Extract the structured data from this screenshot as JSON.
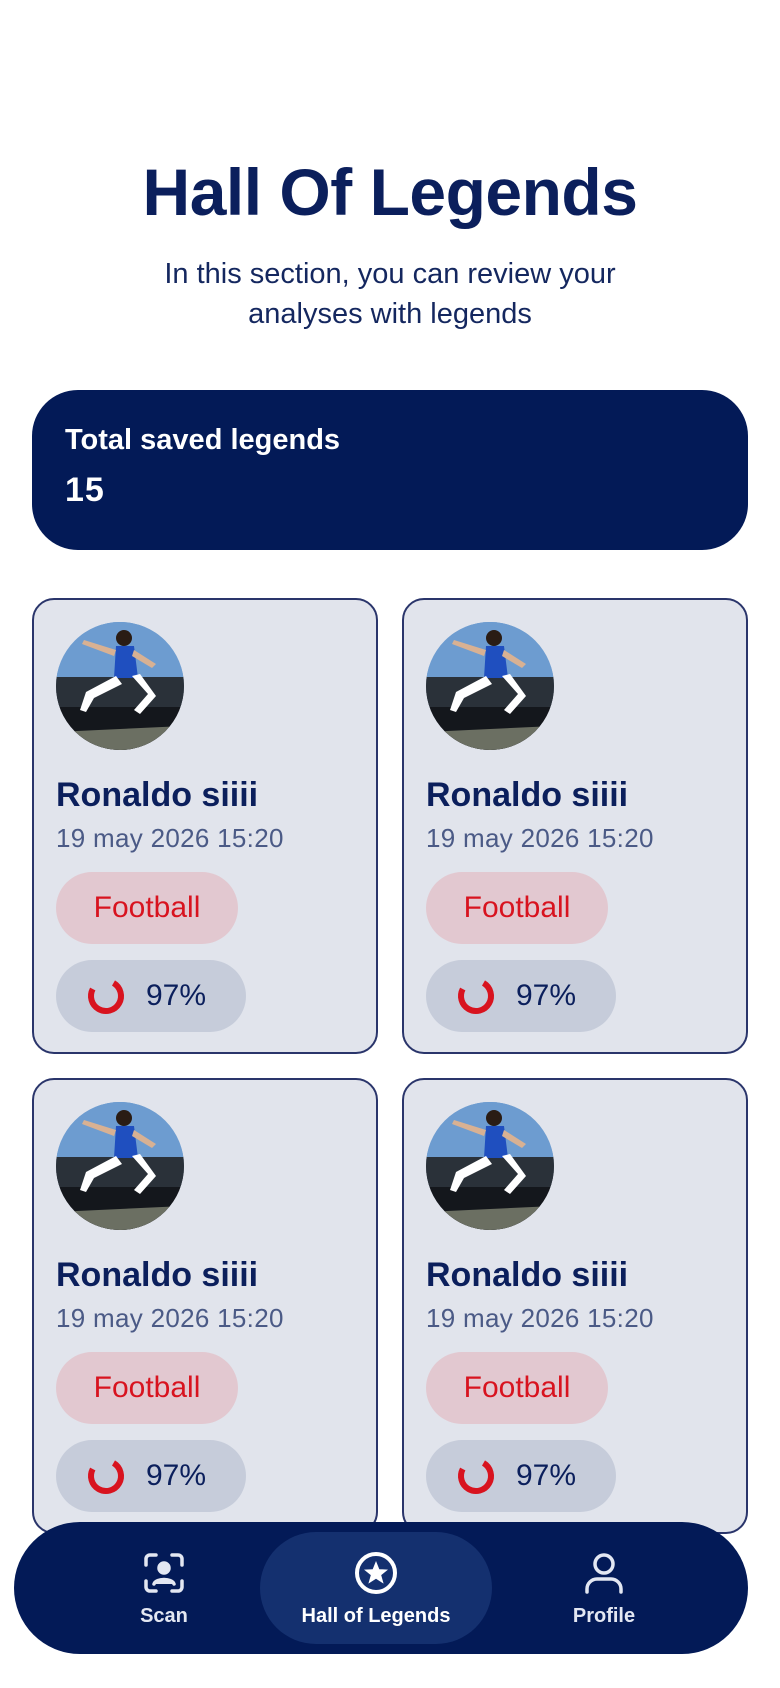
{
  "header": {
    "title": "Hall Of Legends",
    "subtitle": "In this section, you can review your analyses with legends"
  },
  "summary": {
    "label": "Total saved legends",
    "value": "15"
  },
  "cards": [
    {
      "name": "Ronaldo siiii",
      "date": "19 may 2026 15:20",
      "tag": "Football",
      "score": "97%",
      "score_fraction": 0.97
    },
    {
      "name": "Ronaldo siiii",
      "date": "19 may 2026 15:20",
      "tag": "Football",
      "score": "97%",
      "score_fraction": 0.97
    },
    {
      "name": "Ronaldo siiii",
      "date": "19 may 2026 15:20",
      "tag": "Football",
      "score": "97%",
      "score_fraction": 0.97
    },
    {
      "name": "Ronaldo siiii",
      "date": "19 may 2026 15:20",
      "tag": "Football",
      "score": "97%",
      "score_fraction": 0.97
    }
  ],
  "nav": {
    "items": [
      {
        "label": "Scan",
        "icon": "scan-face-icon"
      },
      {
        "label": "Hall of Legends",
        "icon": "star-circle-icon",
        "active": true
      },
      {
        "label": "Profile",
        "icon": "user-icon"
      }
    ]
  },
  "colors": {
    "primary": "#031a57",
    "accent": "#d8131f",
    "card_bg": "#e1e4ec",
    "tag_bg": "#e2c8d0",
    "score_bg": "#c6ccda"
  }
}
